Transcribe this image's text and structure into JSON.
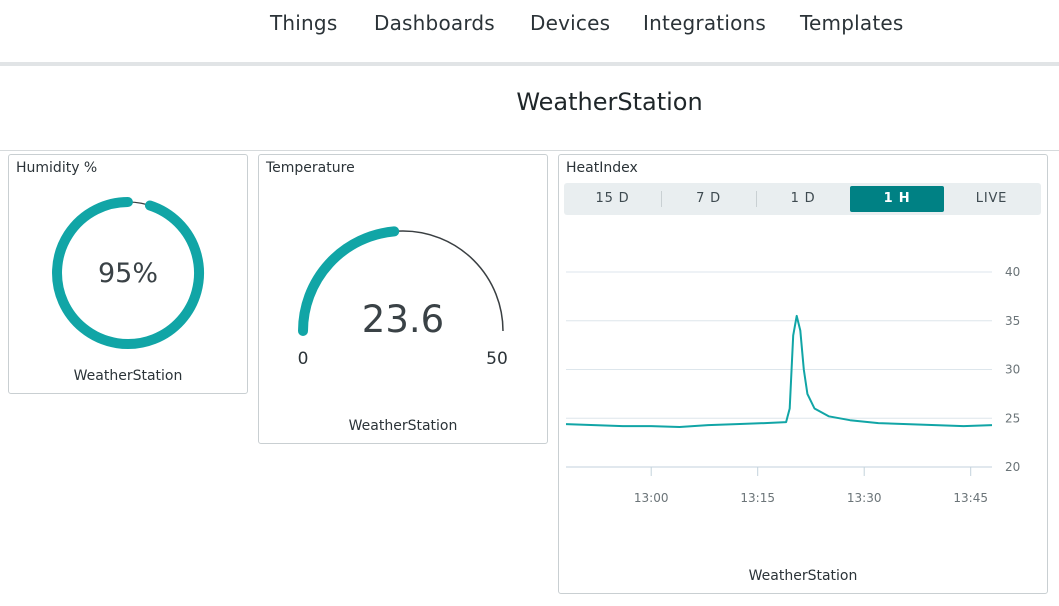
{
  "nav": {
    "items": [
      "Things",
      "Dashboards",
      "Devices",
      "Integrations",
      "Templates"
    ]
  },
  "dashboard": {
    "title": "WeatherStation"
  },
  "colors": {
    "accent": "#11a5a6",
    "active_tab": "#008184",
    "gauge_track": "#3a3f42"
  },
  "widgets": {
    "humidity": {
      "title": "Humidity %",
      "value": 95,
      "value_label": "95%",
      "footer": "WeatherStation"
    },
    "temperature": {
      "title": "Temperature",
      "value": 23.6,
      "value_label": "23.6",
      "min": 0,
      "max": 50,
      "min_label": "0",
      "max_label": "50",
      "footer": "WeatherStation"
    },
    "heatindex": {
      "title": "HeatIndex",
      "tabs": [
        "15 D",
        "7 D",
        "1 D",
        "1 H",
        "LIVE"
      ],
      "active_tab": "1 H",
      "footer": "WeatherStation"
    }
  },
  "chart_data": {
    "type": "line",
    "title": "HeatIndex",
    "xlabel": "",
    "ylabel": "",
    "y_ticks": [
      20,
      25,
      30,
      35,
      40
    ],
    "ylim": [
      20,
      40
    ],
    "x_ticks": [
      "13:00",
      "13:15",
      "13:30",
      "13:45"
    ],
    "xlim": [
      "12:48",
      "13:48"
    ],
    "grid": true,
    "series": [
      {
        "color": "#11a5a6",
        "points": [
          [
            "12:48",
            24.4
          ],
          [
            "12:52",
            24.3
          ],
          [
            "12:56",
            24.2
          ],
          [
            "13:00",
            24.2
          ],
          [
            "13:04",
            24.1
          ],
          [
            "13:08",
            24.3
          ],
          [
            "13:12",
            24.4
          ],
          [
            "13:16",
            24.5
          ],
          [
            "13:19",
            24.6
          ],
          [
            "13:19.5",
            26.0
          ],
          [
            "13:20",
            33.5
          ],
          [
            "13:20.5",
            35.5
          ],
          [
            "13:21",
            34.0
          ],
          [
            "13:21.5",
            30.0
          ],
          [
            "13:22",
            27.5
          ],
          [
            "13:23",
            26.0
          ],
          [
            "13:25",
            25.2
          ],
          [
            "13:28",
            24.8
          ],
          [
            "13:32",
            24.5
          ],
          [
            "13:36",
            24.4
          ],
          [
            "13:40",
            24.3
          ],
          [
            "13:44",
            24.2
          ],
          [
            "13:48",
            24.3
          ]
        ]
      }
    ]
  }
}
